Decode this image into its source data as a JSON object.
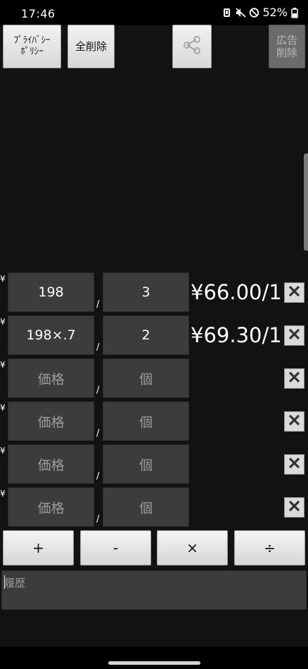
{
  "status_bar": {
    "time": "17:46",
    "battery": "52%"
  },
  "toolbar": {
    "privacy_label": "ﾌﾟﾗｲﾊﾞｼｰ\nﾎﾟﾘｼｰ",
    "clear_all_label": "全削除",
    "share_icon": "share-icon",
    "remove_ads_label": "広告\n削除"
  },
  "rows": [
    {
      "currency": "¥",
      "price": "198",
      "qty": "3",
      "separator": "/",
      "result": "¥66.00/1"
    },
    {
      "currency": "¥",
      "price": "198×.7",
      "qty": "2",
      "separator": "/",
      "result": "¥69.30/1"
    },
    {
      "currency": "¥",
      "price_placeholder": "価格",
      "qty_placeholder": "個",
      "separator": "/"
    },
    {
      "currency": "¥",
      "price_placeholder": "価格",
      "qty_placeholder": "個",
      "separator": "/"
    },
    {
      "currency": "¥",
      "price_placeholder": "価格",
      "qty_placeholder": "個",
      "separator": "/"
    },
    {
      "currency": "¥",
      "price_placeholder": "価格",
      "qty_placeholder": "個",
      "separator": "/"
    }
  ],
  "operators": {
    "plus": "+",
    "minus": "-",
    "multiply": "×",
    "divide": "÷"
  },
  "history": {
    "placeholder": "履歴"
  },
  "colors": {
    "background": "#121212",
    "field": "#3c3c3c",
    "button": "#e0e0e0",
    "ads_button": "#6b6b6b"
  }
}
